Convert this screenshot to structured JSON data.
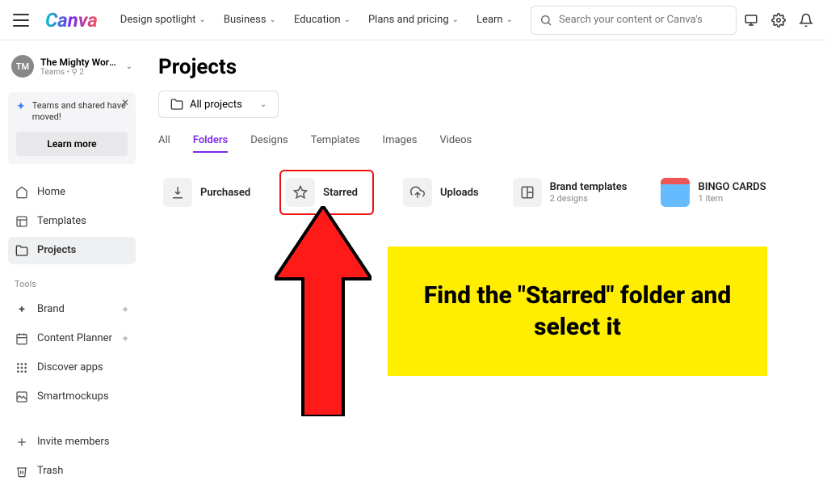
{
  "topnav": {
    "logo": "Canva",
    "items": [
      "Design spotlight",
      "Business",
      "Education",
      "Plans and pricing",
      "Learn"
    ],
    "search_placeholder": "Search your content or Canva's"
  },
  "team": {
    "initials": "TM",
    "name": "The Mighty WordS...",
    "meta": "Teams • ⚲ 2"
  },
  "banner": {
    "text": "Teams and shared have moved!",
    "learn": "Learn more"
  },
  "nav": {
    "main": [
      {
        "icon": "home",
        "label": "Home"
      },
      {
        "icon": "templates",
        "label": "Templates"
      },
      {
        "icon": "projects",
        "label": "Projects",
        "active": true
      }
    ],
    "tools_label": "Tools",
    "tools": [
      {
        "icon": "brand",
        "label": "Brand",
        "trail": "✦"
      },
      {
        "icon": "planner",
        "label": "Content Planner",
        "trail": "✦"
      },
      {
        "icon": "apps",
        "label": "Discover apps"
      },
      {
        "icon": "mockups",
        "label": "Smartmockups"
      }
    ],
    "bottom": [
      {
        "icon": "plus",
        "label": "Invite members"
      },
      {
        "icon": "trash",
        "label": "Trash"
      }
    ]
  },
  "page": {
    "title": "Projects",
    "filter_label": "All projects",
    "tabs": [
      "All",
      "Folders",
      "Designs",
      "Templates",
      "Images",
      "Videos"
    ],
    "active_tab": "Folders",
    "folders": [
      {
        "icon": "download",
        "name": "Purchased"
      },
      {
        "icon": "star",
        "name": "Starred",
        "highlight": true
      },
      {
        "icon": "upload",
        "name": "Uploads"
      },
      {
        "icon": "brand-tpl",
        "name": "Brand templates",
        "meta": "2 designs"
      },
      {
        "icon": "bingo",
        "name": "BINGO CARDS",
        "meta": "1 item"
      }
    ]
  },
  "callout": "Find the \"Starred\" folder and select it"
}
